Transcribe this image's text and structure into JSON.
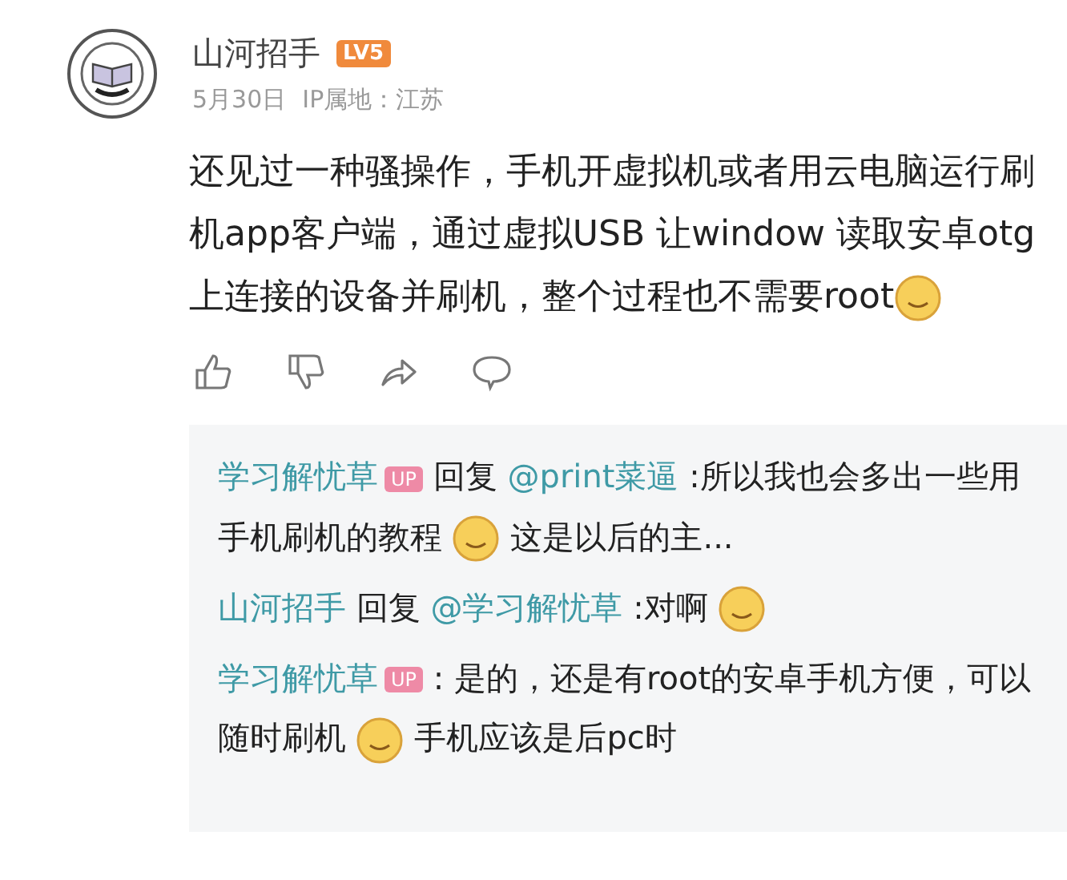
{
  "post": {
    "author": "山河招手",
    "level": "LV5",
    "date": "5月30日",
    "ip": "IP属地：江苏",
    "content": [
      {
        "kind": "text",
        "text": "还见过一种骚操作，手机开虚拟机或者用云电脑运行刷机app客户端，通过虚拟USB 让window 读取安卓otg上连接的设备并刷机，整个过程也不需要root"
      },
      {
        "kind": "emoji"
      }
    ]
  },
  "replies": [
    {
      "segments": [
        {
          "kind": "name",
          "text": "学习解忧草"
        },
        {
          "kind": "badge",
          "text": "UP"
        },
        {
          "kind": "text",
          "text": "回复"
        },
        {
          "kind": "mention",
          "text": "@print菜逼"
        },
        {
          "kind": "text",
          "text": ":所以我也会多出一些用手机刷机的教程"
        },
        {
          "kind": "emoji"
        },
        {
          "kind": "text",
          "text": "这是以后的主..."
        }
      ]
    },
    {
      "segments": [
        {
          "kind": "name",
          "text": "山河招手"
        },
        {
          "kind": "text",
          "text": "回复"
        },
        {
          "kind": "mention",
          "text": "@学习解忧草"
        },
        {
          "kind": "text",
          "text": ":对啊"
        },
        {
          "kind": "emoji"
        }
      ]
    },
    {
      "segments": [
        {
          "kind": "name",
          "text": "学习解忧草"
        },
        {
          "kind": "badge",
          "text": "UP"
        },
        {
          "kind": "text",
          "text": ": 是的，还是有root的安卓手机方便，可以随时刷机"
        },
        {
          "kind": "emoji"
        },
        {
          "kind": "text",
          "text": "手机应该是后pc时"
        }
      ]
    }
  ]
}
